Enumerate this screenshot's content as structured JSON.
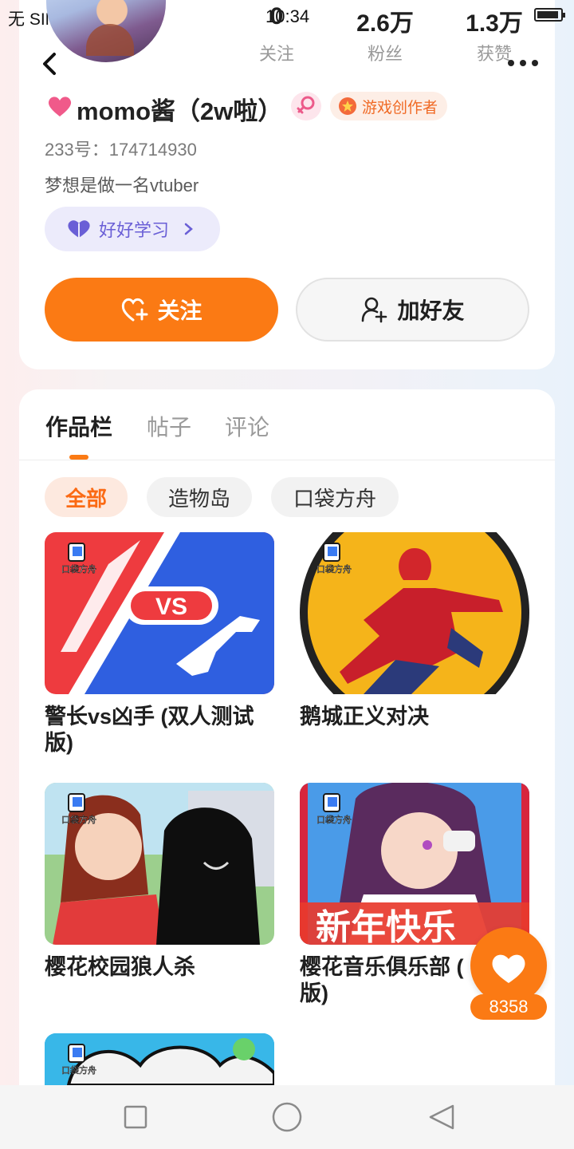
{
  "status_bar": {
    "carrier": "无 SIM 卡",
    "time": "10:34"
  },
  "header": {
    "stats": [
      {
        "value": "0",
        "label": "关注"
      },
      {
        "value": "2.6万",
        "label": "粉丝"
      },
      {
        "value": "1.3万",
        "label": "获赞"
      }
    ]
  },
  "profile": {
    "name": "momo酱（2w啦）",
    "badge_label": "游戏创作者",
    "uid": "233号：174714930",
    "bio": "梦想是做一名vtuber",
    "study_tag": "好好学习",
    "follow_label": "关注",
    "add_friend_label": "加好友"
  },
  "tabs": [
    {
      "label": "作品栏",
      "active": true
    },
    {
      "label": "帖子",
      "active": false
    },
    {
      "label": "评论",
      "active": false
    }
  ],
  "filters": [
    {
      "label": "全部",
      "active": true
    },
    {
      "label": "造物岛",
      "active": false
    },
    {
      "label": "口袋方舟",
      "active": false
    }
  ],
  "works": [
    {
      "title": "警长vs凶手 (双人测试版)",
      "thumb_text": "VS"
    },
    {
      "title": "鹅城正义对决"
    },
    {
      "title": "樱花校园狼人杀"
    },
    {
      "title": "樱花音乐俱乐部 (",
      "title_line2": "版)",
      "thumb_text": "新年快乐"
    }
  ],
  "logo_text": "口袋方舟",
  "like_count": "8358",
  "colors": {
    "accent": "#fb7a14",
    "purple": "#6a5fd6"
  }
}
